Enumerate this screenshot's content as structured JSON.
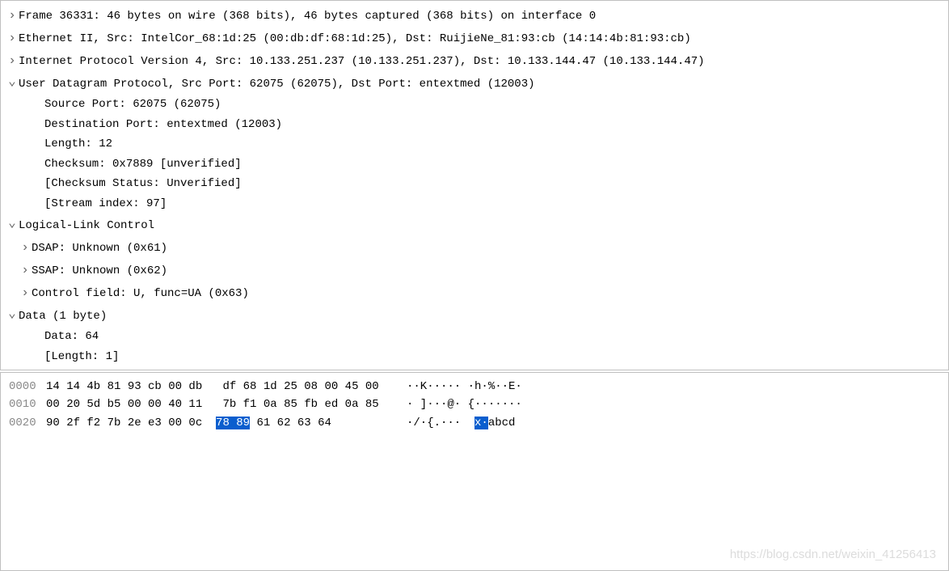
{
  "tree": {
    "frame": "Frame 36331: 46 bytes on wire (368 bits), 46 bytes captured (368 bits) on interface 0",
    "eth": "Ethernet II, Src: IntelCor_68:1d:25 (00:db:df:68:1d:25), Dst: RuijieNe_81:93:cb (14:14:4b:81:93:cb)",
    "ip": "Internet Protocol Version 4, Src: 10.133.251.237 (10.133.251.237), Dst: 10.133.144.47 (10.133.144.47)",
    "udp": "User Datagram Protocol, Src Port: 62075 (62075), Dst Port: entextmed (12003)",
    "udp_src": "Source Port: 62075 (62075)",
    "udp_dst": "Destination Port: entextmed (12003)",
    "udp_len": "Length: 12",
    "udp_cksum": "Checksum: 0x7889 [unverified]",
    "udp_cksum_stat": "[Checksum Status: Unverified]",
    "udp_stream": "[Stream index: 97]",
    "llc": "Logical-Link Control",
    "llc_dsap": "DSAP: Unknown (0x61)",
    "llc_ssap": "SSAP: Unknown (0x62)",
    "llc_ctrl": "Control field: U, func=UA (0x63)",
    "data": "Data (1 byte)",
    "data_val": "Data: 64",
    "data_len": "[Length: 1]"
  },
  "hex": {
    "rows": [
      {
        "offset": "0000",
        "b1": "14 14 4b 81 93 cb 00 db",
        "b2": "df 68 1d 25 08 00 45 00",
        "a1": "··K·····",
        "a2": "·h·%··E·"
      },
      {
        "offset": "0010",
        "b1": "00 20 5d b5 00 00 40 11",
        "b2": "7b f1 0a 85 fb ed 0a 85",
        "a1": "· ]···@·",
        "a2": "{·······"
      },
      {
        "offset": "0020",
        "b1_pre": "90 2f f2 7b 2e e3 00 0c  ",
        "b_hl": "78 89",
        "b2_post": " 61 62 63 64",
        "a_pre": "·/·{.···  ",
        "a_hl": "x·",
        "a_post": "abcd"
      }
    ]
  },
  "watermark": "https://blog.csdn.net/weixin_41256413"
}
